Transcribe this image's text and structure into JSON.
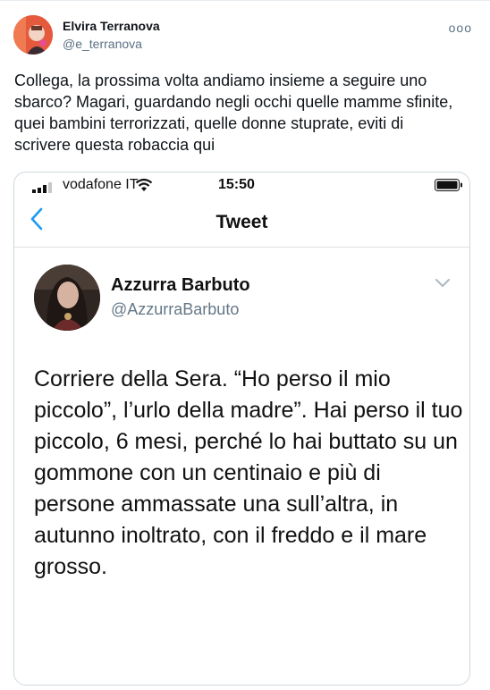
{
  "author": {
    "name": "Elvira Terranova",
    "handle": "@e_terranova"
  },
  "more_label": "ooo",
  "tweet_text": "Collega, la prossima volta andiamo insieme a seguire uno sbarco? Magari, guardando negli occhi quelle mamme sfinite, quei bambini terrorizzati, quelle donne stuprate, eviti di scrivere questa robaccia qui",
  "screenshot": {
    "status_bar": {
      "carrier": "vodafone IT",
      "time": "15:50"
    },
    "nav": {
      "title": "Tweet"
    },
    "quoted": {
      "name": "Azzurra Barbuto",
      "handle": "@AzzurraBarbuto",
      "text": "Corriere della Sera. “Ho perso il mio piccolo”, l’urlo della madre”. Hai perso il tuo piccolo, 6 mesi, perché lo hai buttato su un gommone con un centinaio e più di persone ammassate una sull’altra, in autunno inoltrato, con il freddo e il mare grosso."
    }
  },
  "colors": {
    "accent": "#1d9bf0",
    "secondary_text": "#5b7083",
    "border": "#cfd9de"
  },
  "icons": [
    "more-icon",
    "signal-icon",
    "wifi-icon",
    "battery-icon",
    "back-chevron-icon",
    "chevron-down-icon"
  ]
}
